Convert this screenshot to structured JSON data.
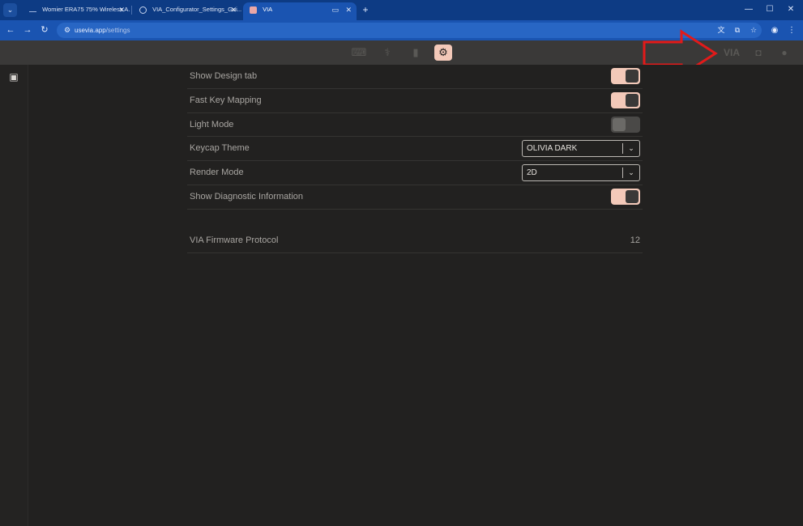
{
  "browser": {
    "tabs": [
      {
        "label": "Womier ERA75 75% Wireless A...",
        "favicon": "womier-favicon",
        "active": false
      },
      {
        "label": "VIA_Configurator_Settings_Gui...",
        "favicon": "globe-favicon",
        "active": false
      },
      {
        "label": "VIA",
        "favicon": "via-favicon",
        "active": true
      }
    ],
    "new_tab_glyph": "+",
    "window_controls": {
      "minimize": "—",
      "maximize": "☐",
      "close": "✕"
    },
    "url_host": "usevia.app",
    "url_path": "/settings"
  },
  "app": {
    "mode_icons": [
      "keyboard-icon",
      "test-stethoscope-icon",
      "design-paint-icon",
      "settings-gear-icon"
    ],
    "active_mode": "settings-gear-icon",
    "brand": "VIA",
    "accent_color": "#f3c9b9"
  },
  "settings": {
    "rows": [
      {
        "label": "Show Design tab",
        "type": "toggle",
        "on": true
      },
      {
        "label": "Fast Key Mapping",
        "type": "toggle",
        "on": true
      },
      {
        "label": "Light Mode",
        "type": "toggle",
        "on": false
      },
      {
        "label": "Keycap Theme",
        "type": "select",
        "value": "OLIVIA DARK"
      },
      {
        "label": "Render Mode",
        "type": "select",
        "value": "2D"
      },
      {
        "label": "Show Diagnostic Information",
        "type": "toggle",
        "on": true
      }
    ],
    "firmware": {
      "label": "VIA Firmware Protocol",
      "value": "12"
    }
  }
}
